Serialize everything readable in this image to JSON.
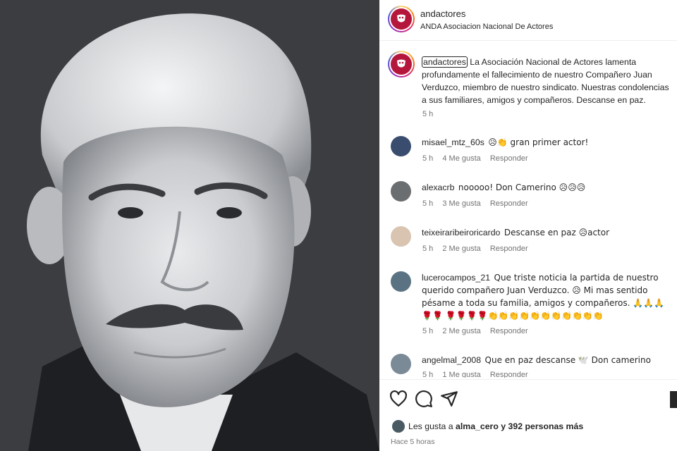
{
  "post": {
    "author": "andactores",
    "author_full": "ANDA Asociacion Nacional De Actores",
    "caption_user": "andactores",
    "caption": "La Asociación Nacional de Actores lamenta profundamente el fallecimiento de nuestro Compañero Juan Verduzco, miembro de nuestro sindicato. Nuestras condolencias a sus familiares, amigos y compañeros. Descanse en paz.",
    "caption_time": "5 h"
  },
  "comments": [
    {
      "user": "misael_mtz_60s",
      "text": "😥👏 gran primer actor!",
      "time": "5 h",
      "likes": "4 Me gusta",
      "reply": "Responder"
    },
    {
      "user": "alexacrb",
      "text": "nooooo! Don Camerino 😥😥😥",
      "time": "5 h",
      "likes": "3 Me gusta",
      "reply": "Responder"
    },
    {
      "user": "teixeiraribeiroricardo",
      "text": "Descanse en paz 😥actor",
      "time": "5 h",
      "likes": "2 Me gusta",
      "reply": "Responder"
    },
    {
      "user": "lucerocampos_21",
      "text": "Que triste noticia la partida de nuestro querido compañero Juan Verduzco. 😥 Mi mas sentido pésame a toda su familia, amigos y compañeros. 🙏🙏🙏🌹🌹 🌹🌹🌹🌹👏👏👏👏👏👏👏👏👏👏👏",
      "time": "5 h",
      "likes": "2 Me gusta",
      "reply": "Responder"
    },
    {
      "user": "angelmal_2008",
      "text": "Que en paz descanse 🕊️ Don camerino",
      "time": "5 h",
      "likes": "1 Me gusta",
      "reply": "Responder"
    }
  ],
  "footer": {
    "likes_prefix": "Les gusta a",
    "likes_user": "alma_cero",
    "likes_suffix": "y 392 personas más",
    "ago": "Hace 5 horas"
  },
  "icons": [
    "heart-icon",
    "comment-icon",
    "share-icon",
    "bookmark-icon"
  ],
  "colors": {
    "text": "#262626",
    "muted": "#737373",
    "brand": "#b5173c"
  }
}
